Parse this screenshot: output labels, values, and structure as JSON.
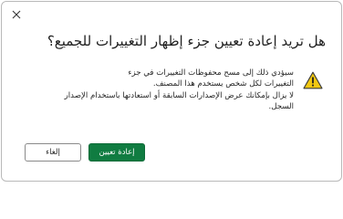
{
  "dialog": {
    "title": "هل تريد إعادة تعيين جزء إظهار التغييرات للجميع؟",
    "message_line1": "سيؤدي ذلك إلى مسح محفوظات التغييرات في جزء",
    "message_line2": "التغييرات لكل شخص يستخدم هذا المصنف.",
    "message_line3": "لا يزال بإمكانك عرض الإصدارات السابقة أو استعادتها باستخدام الإصدار",
    "message_line4": "السجل.",
    "reset_label": "إعادة تعيين",
    "cancel_label": "إلغاء",
    "icons": {
      "close": "close-icon",
      "warning": "warning-icon"
    },
    "colors": {
      "primary_button": "#107c41",
      "warning_fill": "#f2c811"
    }
  }
}
